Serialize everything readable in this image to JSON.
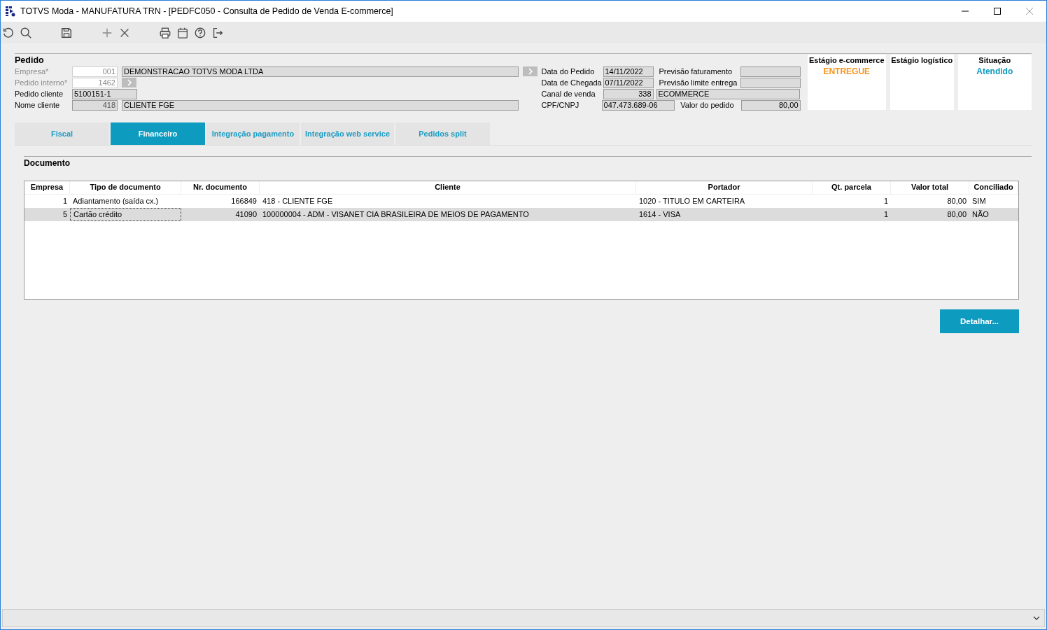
{
  "window": {
    "title": "TOTVS Moda - MANUFATURA TRN - [PEDFC050 - Consulta de Pedido de Venda E-commerce]"
  },
  "pedido": {
    "title": "Pedido",
    "fields": [
      {
        "kind": "code_name",
        "label": "Empresa*",
        "required": true,
        "code": "001",
        "editable": true,
        "name": "DEMONSTRACAO TOTVS MODA LTDA"
      },
      {
        "kind": "code_button",
        "label": "Pedido interno*",
        "required": true,
        "code": "1462",
        "editable": true
      },
      {
        "kind": "text",
        "label": "Pedido cliente",
        "required": false,
        "value": "5100151-1"
      },
      {
        "kind": "code_name",
        "label": "Nome cliente",
        "required": false,
        "code": "418",
        "editable": false,
        "name": "CLIENTE FGE"
      }
    ]
  },
  "info": [
    {
      "kind": "two_pairs",
      "label": "Data do Pedido",
      "value": "14/11/2022",
      "label2": "Previsão faturamento"
    },
    {
      "kind": "two_pairs",
      "label": "Data de Chegada",
      "value": "07/11/2022",
      "label2": "Previsão limite entrega"
    },
    {
      "kind": "code_name",
      "label": "Canal de venda",
      "code": "338",
      "name": "ECOMMERCE"
    },
    {
      "kind": "wide_pair",
      "label": "CPF/CNPJ",
      "value": "047.473.689-06",
      "label2": "Valor do pedido",
      "value2": "80,00"
    }
  ],
  "status_cards": [
    {
      "title": "Estágio e-commerce",
      "value": "ENTREGUE",
      "color": "#f7941d"
    },
    {
      "title": "Estágio logístico"
    },
    {
      "title": "Situação",
      "value": "Atendido",
      "color": "#0e9bc0"
    }
  ],
  "tabs": [
    {
      "label": "Fiscal",
      "selected": false
    },
    {
      "label": "Financeiro",
      "selected": true
    },
    {
      "label": "Integração pagamento",
      "selected": false
    },
    {
      "label": "Integração web service",
      "selected": false
    },
    {
      "label": "Pedidos split",
      "selected": false
    }
  ],
  "section_title": "Documento",
  "table": {
    "columns": [
      "Empresa",
      "Tipo de documento",
      "Nr. documento",
      "Cliente",
      "Portador",
      "Qt. parcela",
      "Valor total",
      "Conciliado"
    ],
    "rows": [
      {
        "selected": false,
        "cells": [
          "1",
          "Adiantamento (saída cx.)",
          "166849",
          "418 - CLIENTE FGE",
          "1020 - TITULO EM CARTEIRA",
          "1",
          "80,00",
          "SIM"
        ]
      },
      {
        "selected": true,
        "cells": [
          "5",
          "Cartão crédito",
          "41090",
          "100000004 - ADM - VISANET CIA BRASILEIRA DE MEIOS DE PAGAMENTO",
          "1614 - VISA",
          "1",
          "80,00",
          "NÃO"
        ]
      }
    ]
  },
  "detail_button": "Detalhar..."
}
